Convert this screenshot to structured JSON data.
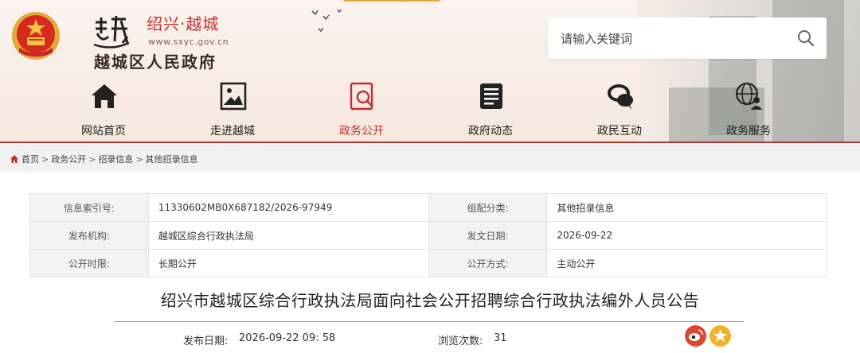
{
  "header": {
    "brand": "绍兴·越城",
    "url": "www.sxyc.gov.cn",
    "gov_name": "越城区人民政府",
    "logo_char": "越"
  },
  "search": {
    "placeholder": "请输入关键词"
  },
  "nav": {
    "items": [
      {
        "label": "网站首页",
        "icon": "home-icon"
      },
      {
        "label": "走进越城",
        "icon": "picture-icon"
      },
      {
        "label": "政务公开",
        "icon": "document-search-icon",
        "active": true
      },
      {
        "label": "政府动态",
        "icon": "news-list-icon"
      },
      {
        "label": "政民互动",
        "icon": "chat-icon"
      },
      {
        "label": "政务服务",
        "icon": "globe-user-icon"
      }
    ],
    "accent_color": "#c62e2e"
  },
  "breadcrumb": [
    "首页",
    "政务公开",
    "招录信息",
    "其他招录信息"
  ],
  "info": {
    "rows": [
      {
        "k1": "信息索引号:",
        "v1": "11330602MB0X687182/2026-97949",
        "k2": "组配分类:",
        "v2": "其他招录信息"
      },
      {
        "k1": "发布机构:",
        "v1": "越城区综合行政执法局",
        "k2": "发文日期:",
        "v2": "2026-09-22"
      },
      {
        "k1": "公开时限:",
        "v1": "长期公开",
        "k2": "公开方式:",
        "v2": "主动公开"
      }
    ]
  },
  "article": {
    "title": "绍兴市越城区综合行政执法局面向社会公开招聘综合行政执法编外人员公告",
    "publish_label": "发布日期:",
    "publish_value": "2026-09-22 09: 58",
    "views_label": "浏览次数:",
    "views_value": "31"
  },
  "share": [
    "weibo-icon",
    "star-icon"
  ]
}
